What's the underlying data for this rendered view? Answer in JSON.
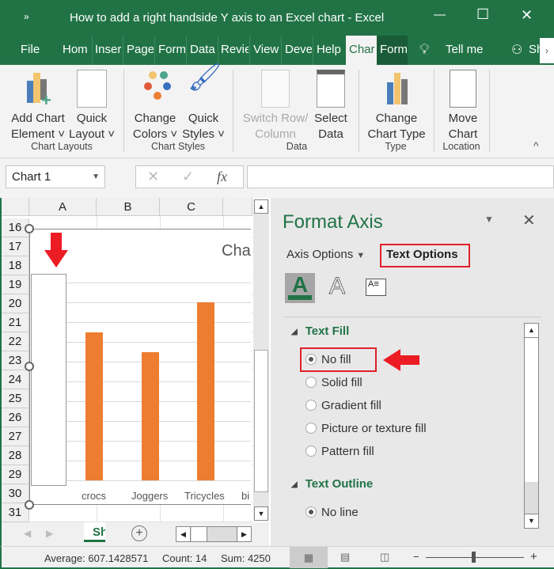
{
  "window": {
    "title": "How to add a right handside Y axis to an Excel chart  -  Excel",
    "minimize": "—",
    "maximize": "☐",
    "close": "✕",
    "quick_access": "»"
  },
  "tabs": [
    {
      "label": "File"
    },
    {
      "label": "Hom"
    },
    {
      "label": "Inser"
    },
    {
      "label": "Page"
    },
    {
      "label": "Form"
    },
    {
      "label": "Data"
    },
    {
      "label": "Revie"
    },
    {
      "label": "View"
    },
    {
      "label": "Deve"
    },
    {
      "label": "Help"
    },
    {
      "label": "Char"
    },
    {
      "label": "Form"
    }
  ],
  "tell_me": "Tell me",
  "share": "Sh",
  "ribbon": {
    "buttons": [
      {
        "line1": "Add Chart",
        "line2": "Element ˅"
      },
      {
        "line1": "Quick",
        "line2": "Layout ˅"
      },
      {
        "line1": "Change",
        "line2": "Colors ˅"
      },
      {
        "line1": "Quick",
        "line2": "Styles ˅"
      },
      {
        "line1": "Switch Row/",
        "line2": "Column"
      },
      {
        "line1": "Select",
        "line2": "Data"
      },
      {
        "line1": "Change",
        "line2": "Chart Type"
      },
      {
        "line1": "Move",
        "line2": "Chart"
      }
    ],
    "groups": [
      "Chart Layouts",
      "Chart Styles",
      "Data",
      "Type",
      "Location"
    ],
    "collapse": "^"
  },
  "formula_bar": {
    "name_box": "Chart 1",
    "cancel": "✕",
    "enter": "✓",
    "fx": "fx",
    "value": ""
  },
  "sheet": {
    "columns": [
      "A",
      "B",
      "C"
    ],
    "rows": [
      "16",
      "17",
      "18",
      "19",
      "20",
      "21",
      "22",
      "23",
      "24",
      "25",
      "26",
      "27",
      "28",
      "29",
      "30",
      "31"
    ],
    "tab": "Sh"
  },
  "chart": {
    "title_partial": "Cha",
    "categories": [
      "crocs",
      "Joggers",
      "Tricycles",
      "bi"
    ],
    "bar_color": "#ed7d31"
  },
  "panel": {
    "title": "Format Axis",
    "axis_options": "Axis Options",
    "text_options": "Text Options",
    "text_fill": {
      "heading": "Text Fill",
      "options": [
        {
          "label": "No fill",
          "selected": true
        },
        {
          "label": "Solid fill",
          "selected": false
        },
        {
          "label": "Gradient fill",
          "selected": false
        },
        {
          "label": "Picture or texture fill",
          "selected": false
        },
        {
          "label": "Pattern fill",
          "selected": false
        }
      ]
    },
    "text_outline": {
      "heading": "Text Outline",
      "options": [
        {
          "label": "No line",
          "selected": true
        }
      ]
    }
  },
  "status": {
    "average": "Average: 607.1428571",
    "count": "Count: 14",
    "sum": "Sum: 4250",
    "zoom_minus": "−",
    "zoom_plus": "+"
  },
  "colors": {
    "excel_green": "#217346",
    "highlight_red": "#e0202a"
  }
}
